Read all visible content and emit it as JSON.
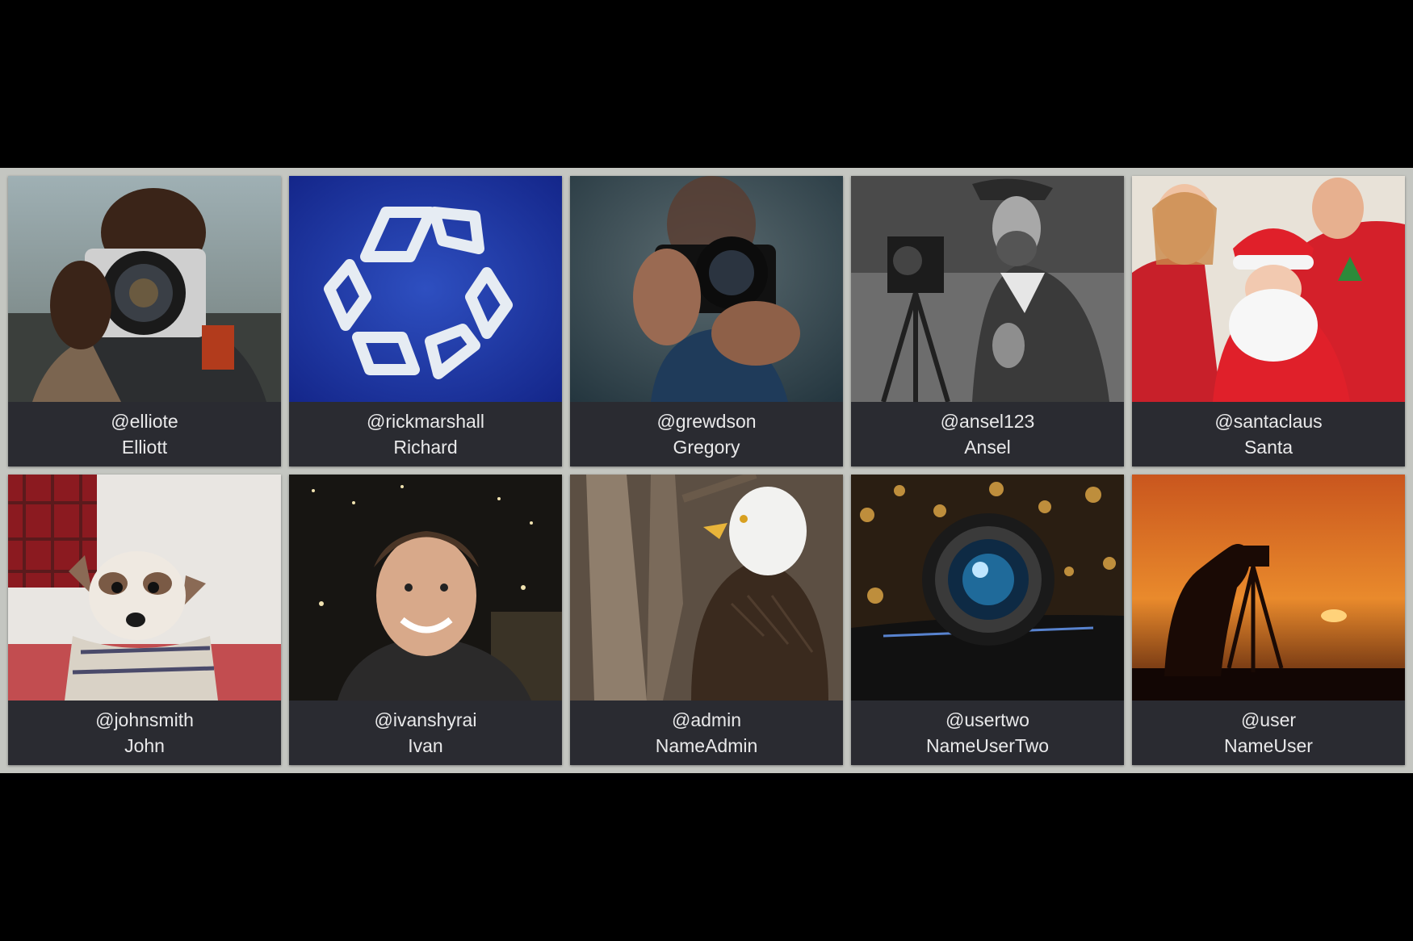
{
  "users": [
    {
      "handle": "@elliote",
      "name": "Elliott",
      "photo": "photographer-with-camera"
    },
    {
      "handle": "@rickmarshall",
      "name": "Richard",
      "photo": "recycle-symbol"
    },
    {
      "handle": "@grewdson",
      "name": "Gregory",
      "photo": "hands-holding-camera"
    },
    {
      "handle": "@ansel123",
      "name": "Ansel",
      "photo": "vintage-photographer-bw"
    },
    {
      "handle": "@santaclaus",
      "name": "Santa",
      "photo": "santa-with-friends"
    },
    {
      "handle": "@johnsmith",
      "name": "John",
      "photo": "dog-in-scarf"
    },
    {
      "handle": "@ivanshyrai",
      "name": "Ivan",
      "photo": "smiling-man-night"
    },
    {
      "handle": "@admin",
      "name": "NameAdmin",
      "photo": "bald-eagle"
    },
    {
      "handle": "@usertwo",
      "name": "NameUserTwo",
      "photo": "camera-lens-bokeh"
    },
    {
      "handle": "@user",
      "name": "NameUser",
      "photo": "sunset-photographer-silhouette"
    }
  ],
  "colors": {
    "page_background": "#000000",
    "strip": "#c4c6c1",
    "caption_background": "#2a2b31",
    "caption_text": "#e9e9ea"
  }
}
